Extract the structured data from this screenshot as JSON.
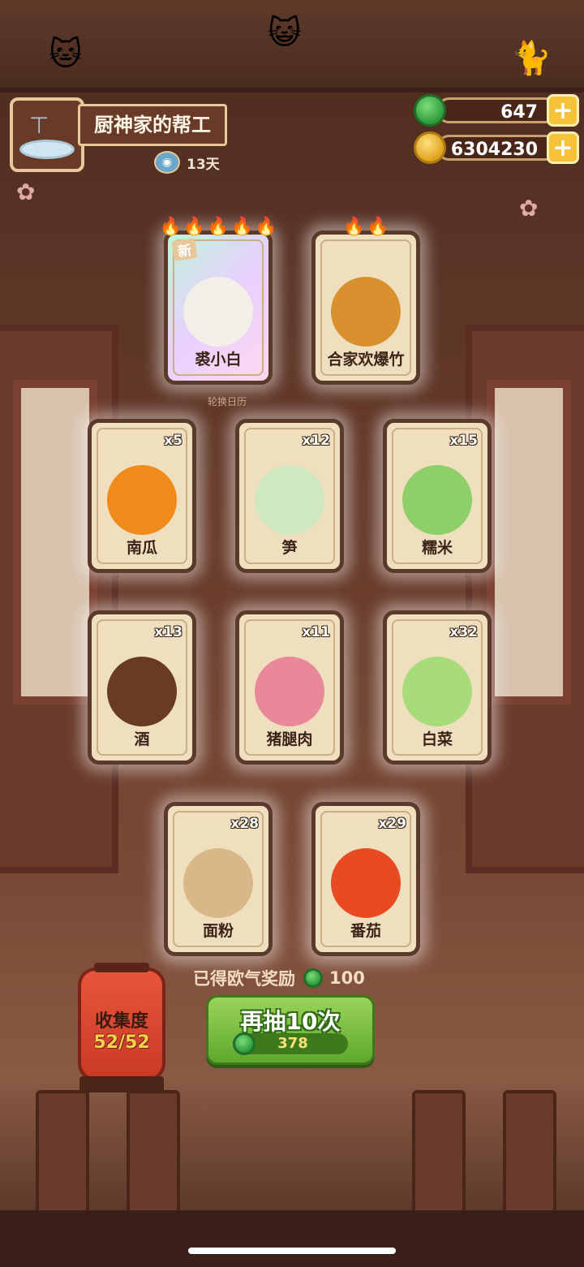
{
  "header": {
    "player_title": "厨神家的帮工",
    "days_label": "13天"
  },
  "currency": {
    "jade": "647",
    "coins": "6304230"
  },
  "cards": [
    {
      "name": "裘小白",
      "count": "",
      "tag": "新",
      "flames": 5,
      "art_icon": "white-cat",
      "art_color": "#f2eee8",
      "special": true
    },
    {
      "name": "合家欢爆竹",
      "count": "",
      "tag": "",
      "flames": 2,
      "art_icon": "firecracker",
      "art_color": "#d9902e",
      "special": false
    },
    {
      "name": "南瓜",
      "count": "x5",
      "tag": "",
      "flames": 0,
      "art_icon": "pumpkin",
      "art_color": "#f08a1a",
      "special": false
    },
    {
      "name": "笋",
      "count": "x12",
      "tag": "",
      "flames": 0,
      "art_icon": "bamboo-shoot",
      "art_color": "#cfe8c0",
      "special": false
    },
    {
      "name": "糯米",
      "count": "x15",
      "tag": "",
      "flames": 0,
      "art_icon": "rice-leaf",
      "art_color": "#8fcf6a",
      "special": false
    },
    {
      "name": "酒",
      "count": "x13",
      "tag": "",
      "flames": 0,
      "art_icon": "wine-jar",
      "art_color": "#6a3a24",
      "special": false
    },
    {
      "name": "猪腿肉",
      "count": "x11",
      "tag": "",
      "flames": 0,
      "art_icon": "pork",
      "art_color": "#e88898",
      "special": false
    },
    {
      "name": "白菜",
      "count": "x32",
      "tag": "",
      "flames": 0,
      "art_icon": "cabbage",
      "art_color": "#a8dc7a",
      "special": false
    },
    {
      "name": "面粉",
      "count": "x28",
      "tag": "",
      "flames": 0,
      "art_icon": "flour-sack",
      "art_color": "#d8b888",
      "special": false
    },
    {
      "name": "番茄",
      "count": "x29",
      "tag": "",
      "flames": 0,
      "art_icon": "tomato",
      "art_color": "#e84a22",
      "special": false
    }
  ],
  "calendar_label": "轮换日历",
  "reward": {
    "label": "已得欧气奖励",
    "amount": "100"
  },
  "draw_button": {
    "label": "再抽10次",
    "cost": "378"
  },
  "collection": {
    "label": "收集度",
    "progress": "52/52"
  },
  "colors": {
    "button_green": "#6cb83a",
    "gold": "#f5c23a",
    "lantern_red": "#d9432c"
  }
}
